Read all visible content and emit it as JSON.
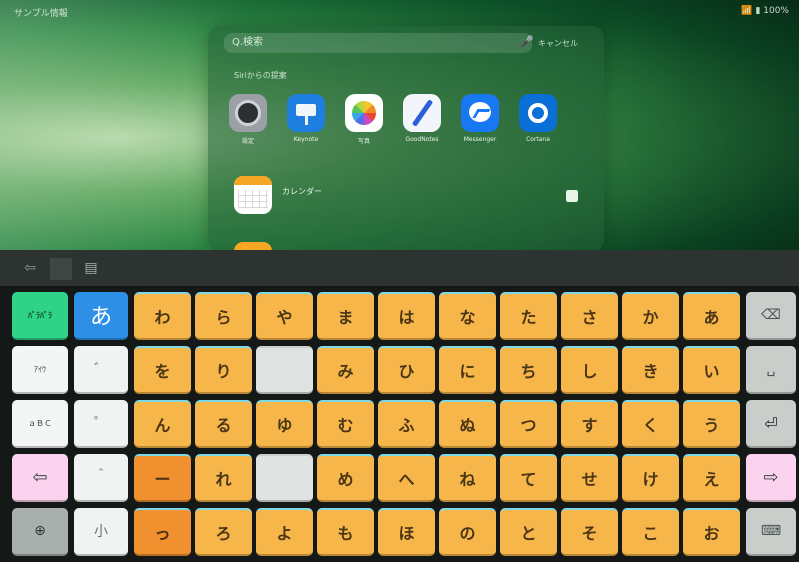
{
  "status_bar": {
    "left": "サンプル情報",
    "right": "📶 ▮ 100%"
  },
  "spotlight": {
    "search_placeholder": "Q.検索",
    "cancel_label": "キャンセル",
    "siri_label": "Siriからの提案",
    "apps": [
      {
        "name": "設定",
        "icon": "settings-icon"
      },
      {
        "name": "Keynote",
        "icon": "keynote-icon"
      },
      {
        "name": "写真",
        "icon": "photos-icon"
      },
      {
        "name": "GoodNotes",
        "icon": "goodnotes-icon"
      },
      {
        "name": "Messenger",
        "icon": "messenger-icon"
      },
      {
        "name": "Cortana",
        "icon": "cortana-icon"
      }
    ],
    "result_title": "カレンダー"
  },
  "candidate_bar": {
    "back": "⇦",
    "doc": "▤"
  },
  "keyboard": {
    "left_column": [
      "ﾊﾞﾗﾊﾞﾗ",
      "ｱｲｳ",
      "ａＢＣ",
      "⇦",
      "⊕"
    ],
    "hiragana_key": "あ",
    "small_keys": [
      "゛",
      "゜",
      "＾",
      "小"
    ],
    "kana_columns": [
      [
        "わ",
        "を",
        "ん",
        "ー",
        "っ"
      ],
      [
        "ら",
        "り",
        "る",
        "れ",
        "ろ"
      ],
      [
        "や",
        "",
        "ゆ",
        "",
        "よ"
      ],
      [
        "ま",
        "み",
        "む",
        "め",
        "も"
      ],
      [
        "は",
        "ひ",
        "ふ",
        "へ",
        "ほ"
      ],
      [
        "な",
        "に",
        "ぬ",
        "ね",
        "の"
      ],
      [
        "た",
        "ち",
        "つ",
        "て",
        "と"
      ],
      [
        "さ",
        "し",
        "す",
        "せ",
        "そ"
      ],
      [
        "か",
        "き",
        "く",
        "け",
        "こ"
      ],
      [
        "あ",
        "い",
        "う",
        "え",
        "お"
      ]
    ],
    "right_column": [
      "⌫",
      "␣",
      "⏎",
      "⇨",
      "⌨"
    ]
  },
  "colors": {
    "kana": "#f7b64a",
    "kana_dark": "#f0902e",
    "hiragana": "#2e8fe6",
    "green_mode": "#2fd388",
    "pink": "#fbd3ee"
  }
}
